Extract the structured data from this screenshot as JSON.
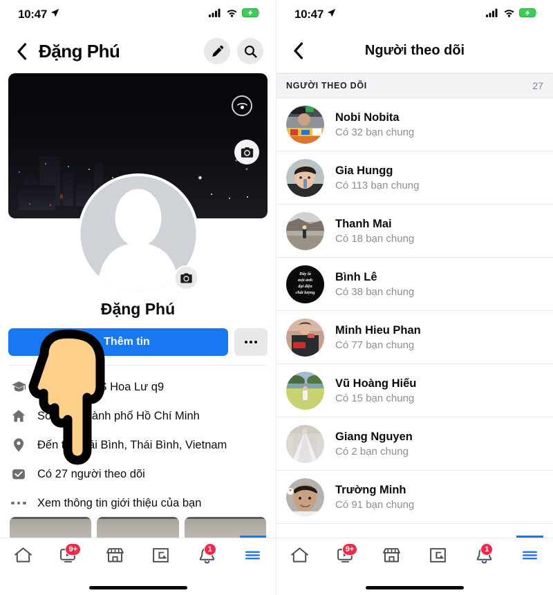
{
  "status_bar": {
    "time": "10:47",
    "location_icon": "location-arrow-icon",
    "cellular_icon": "cellular-bars-icon",
    "wifi_icon": "wifi-icon",
    "battery_icon": "battery-charging-icon",
    "battery_color": "#3dcd58"
  },
  "profile": {
    "back_icon": "chevron-left-icon",
    "title": "Đặng Phú",
    "edit_icon": "pencil-icon",
    "search_icon": "search-icon",
    "cover_pano_icon": "panorama-icon",
    "cover_camera_icon": "camera-icon",
    "avatar_camera_icon": "camera-icon",
    "avatar_icon": "default-person-avatar",
    "name": "Đặng Phú",
    "primary_button": {
      "label": "Thêm tin",
      "icon": "plus-circle-icon",
      "color": "#1877f2"
    },
    "more_button_icon": "ellipsis-icon",
    "info_rows": [
      {
        "icon": "graduation-cap-icon",
        "text": "Học tại THCS Hoa Lư q9"
      },
      {
        "icon": "home-icon",
        "text": "Sống tại thành phố Hồ Chí Minh"
      },
      {
        "icon": "map-pin-icon",
        "text": "Đến từ Thái Bình, Thái Bình, Vietnam"
      },
      {
        "icon": "followers-box-icon",
        "text": "Có 27 người theo dõi"
      },
      {
        "icon": "ellipsis-icon",
        "text": "Xem thông tin giới thiệu của bạn"
      }
    ]
  },
  "followers_screen": {
    "back_icon": "chevron-left-icon",
    "title": "Người theo dõi",
    "section_label": "NGƯỜI THEO DÕI",
    "section_count": "27",
    "items": [
      {
        "name": "Nobi Nobita",
        "mutual": "Có 32 bạn chung",
        "avatar": "photo-avatar-colorful"
      },
      {
        "name": "Gia Hungg",
        "mutual": "Có 113 bạn chung",
        "avatar": "photo-avatar-portrait"
      },
      {
        "name": "Thanh Mai",
        "mutual": "Có 18 bạn chung",
        "avatar": "photo-avatar-outdoor"
      },
      {
        "name": "Bình Lê",
        "mutual": "Có 38 bạn chung",
        "avatar": "text-avatar-black",
        "avatar_text": [
          "Đây là",
          "một ảnh",
          "đại diện",
          "chất lượng"
        ]
      },
      {
        "name": "Minh Hieu Phan",
        "mutual": "Có 77 bạn chung",
        "avatar": "photo-avatar-red"
      },
      {
        "name": "Vũ Hoàng Hiếu",
        "mutual": "Có 15 bạn chung",
        "avatar": "photo-avatar-field"
      },
      {
        "name": "Giang Nguyen",
        "mutual": "Có 2 bạn chung",
        "avatar": "photo-avatar-dress"
      },
      {
        "name": "Trường Minh",
        "mutual": "Có 91 bạn chung",
        "avatar": "photo-avatar-face"
      }
    ]
  },
  "tabbar": {
    "tabs": [
      {
        "name": "home",
        "icon": "home-icon",
        "badge": ""
      },
      {
        "name": "watch",
        "icon": "video-play-icon",
        "badge": "9+"
      },
      {
        "name": "marketplace",
        "icon": "store-icon",
        "badge": ""
      },
      {
        "name": "gaming",
        "icon": "gaming-icon",
        "badge": ""
      },
      {
        "name": "notifications",
        "icon": "bell-icon",
        "badge": "1"
      },
      {
        "name": "menu",
        "icon": "hamburger-icon",
        "badge": "",
        "active": true
      }
    ],
    "accent_color": "#1877f2",
    "badge_color": "#f02849"
  },
  "cursor": {
    "icon": "pointing-hand-cursor",
    "skin": "#fcd08a"
  }
}
